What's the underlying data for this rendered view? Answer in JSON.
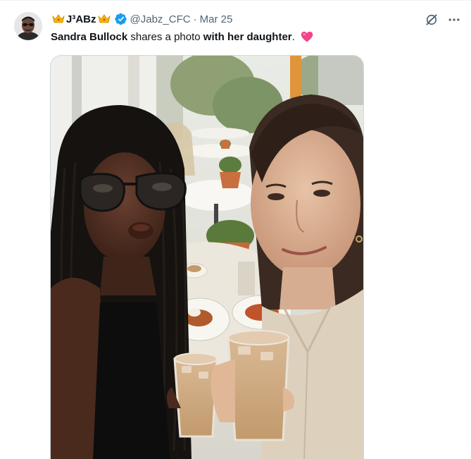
{
  "tweet": {
    "display_name": "J³ABz",
    "handle": "@Jabz_CFC",
    "separator": "·",
    "date": "Mar 25",
    "text_parts": {
      "part1": "Sandra Bullock",
      "part2": " shares a photo ",
      "part3": "with her daughter",
      "part4": "."
    }
  },
  "icons": {
    "crown_left": "crown-icon",
    "crown_right": "crown-icon",
    "verified": "verified-badge-icon",
    "heart": "pink-heart-emoji",
    "grok": "grok-icon",
    "more": "more-horizontal-icon"
  },
  "colors": {
    "verified_blue": "#1d9bf0",
    "secondary_text": "#536471",
    "heart_pink": "#f4448a"
  }
}
